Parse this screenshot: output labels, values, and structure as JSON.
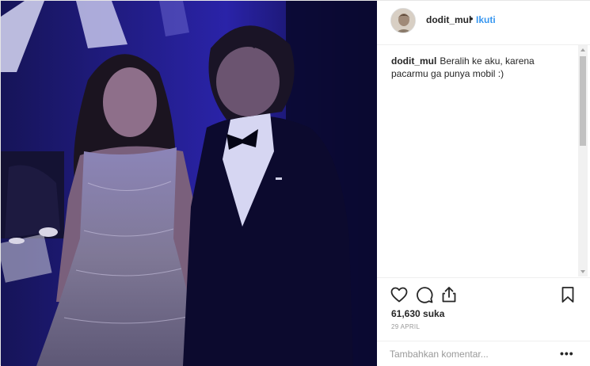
{
  "post": {
    "author": {
      "username": "dodit_mul",
      "avatar_icon": "avatar-photo"
    },
    "follow_label": "Ikuti",
    "separator": "•",
    "caption": {
      "username": "dodit_mul",
      "text": "Beralih ke aku, karena pacarmu ga punya mobil :)"
    },
    "actions": {
      "like_icon": "heart-icon",
      "comment_icon": "comment-icon",
      "share_icon": "share-icon",
      "save_icon": "bookmark-icon"
    },
    "likes_text": "61,630 suka",
    "date_text": "29 APRIL",
    "comment_box": {
      "placeholder": "Tambahkan komentar...",
      "value": ""
    },
    "more_label": "•••",
    "colors": {
      "link": "#3897f0",
      "text": "#262626",
      "muted": "#999999",
      "border": "#efefef"
    }
  }
}
